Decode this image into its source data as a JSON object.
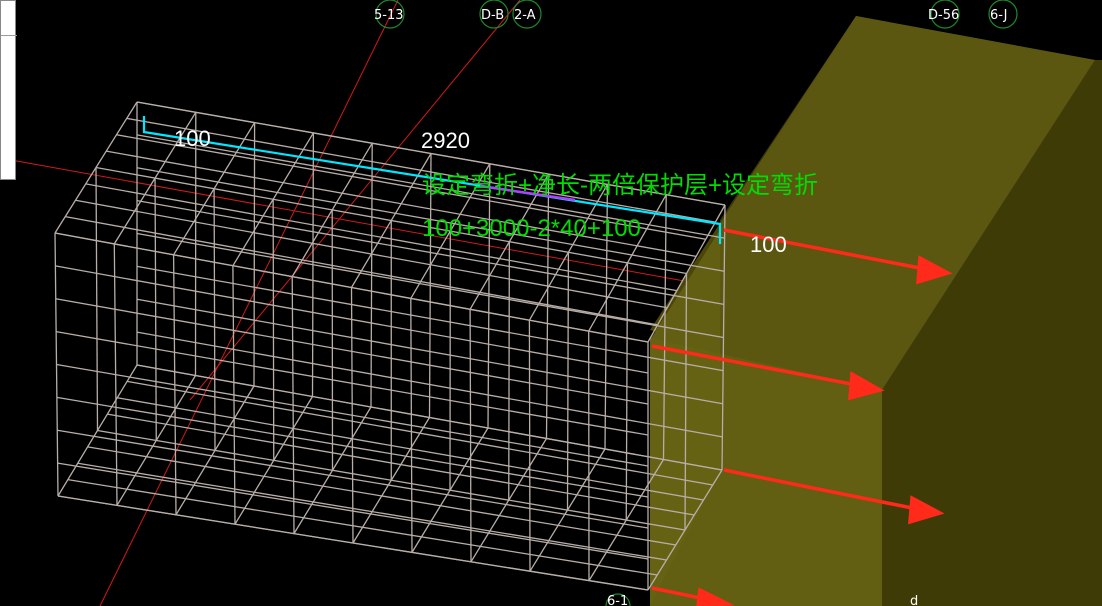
{
  "axis_labels": [
    "5-13",
    "D-B",
    "2-A",
    "D-56",
    "6-J",
    "6-1",
    "d"
  ],
  "dimensions": {
    "total": "2920",
    "left_bend": "100",
    "right_bend": "100"
  },
  "formula": {
    "description": "设定弯折+净长-两倍保护层+设定弯折",
    "expression": "100+3000-2*40+100"
  },
  "colors": {
    "background": "#000000",
    "rebar": "#b8aea8",
    "highlight": "#00e8ff",
    "formula_text": "#00dd00",
    "dimension_text": "#ffffff",
    "arrow": "#ff2a1a",
    "grid_line": "#d11a1a",
    "concrete_face": "#5e5a0e",
    "concrete_side": "#4a4608",
    "concrete_top": "#6d6a14",
    "axis_circle": "#1d8a2a"
  }
}
